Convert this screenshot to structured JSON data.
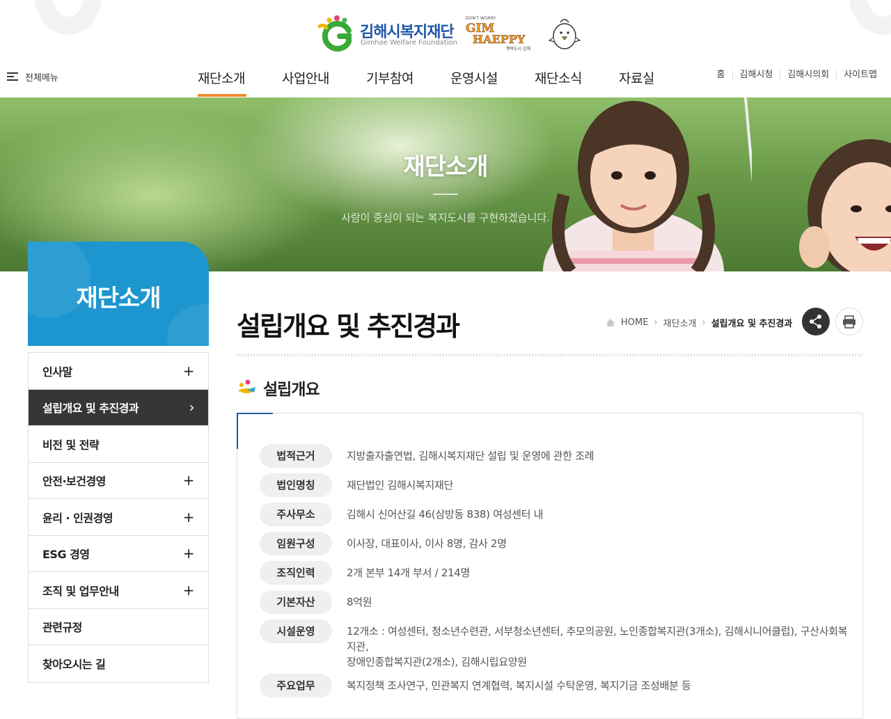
{
  "header": {
    "logo": {
      "name_ko": "김해시복지재단",
      "name_en": "Gimhae Welfare Foundation",
      "slogan_top": "DON'T WORRY",
      "slogan_main": "GIM HAEPPY",
      "slogan_bottom": "행복도시 김해"
    },
    "all_menu_label": "전체메뉴",
    "gnb": [
      {
        "label": "재단소개",
        "active": true
      },
      {
        "label": "사업안내",
        "active": false
      },
      {
        "label": "기부참여",
        "active": false
      },
      {
        "label": "운영시설",
        "active": false
      },
      {
        "label": "재단소식",
        "active": false
      },
      {
        "label": "자료실",
        "active": false
      }
    ],
    "util": [
      "홈",
      "김해시청",
      "김해시의회",
      "사이트맵"
    ]
  },
  "visual": {
    "title": "재단소개",
    "subtitle": "사람이 중심이 되는 복지도시를 구현하겠습니다."
  },
  "lnb": {
    "title": "재단소개",
    "items": [
      {
        "label": "인사말",
        "symbol": "+",
        "active": false
      },
      {
        "label": "설립개요 및 추진경과",
        "symbol": "›",
        "active": true
      },
      {
        "label": "비전 및 전략",
        "symbol": "",
        "active": false
      },
      {
        "label": "안전·보건경영",
        "symbol": "+",
        "active": false
      },
      {
        "label": "윤리 · 인권경영",
        "symbol": "+",
        "active": false
      },
      {
        "label": "ESG 경영",
        "symbol": "+",
        "active": false
      },
      {
        "label": "조직 및 업무안내",
        "symbol": "+",
        "active": false
      },
      {
        "label": "관련규정",
        "symbol": "",
        "active": false
      },
      {
        "label": "찾아오시는 길",
        "symbol": "",
        "active": false
      }
    ]
  },
  "content": {
    "page_title": "설립개요 및 추진경과",
    "breadcrumb": [
      "HOME",
      "재단소개",
      "설립개요 및 추진경과"
    ],
    "section_title": "설립개요",
    "rows": [
      {
        "label": "법적근거",
        "lines": [
          "지방출자출연법, 김해시복지재단 설립 및 운영에 관한 조례"
        ]
      },
      {
        "label": "법인명칭",
        "lines": [
          "재단법인 김해시복지재단"
        ]
      },
      {
        "label": "주사무소",
        "lines": [
          "김해시 신어산길 46(삼방동 838) 여성센터 내"
        ]
      },
      {
        "label": "임원구성",
        "lines": [
          "이사장, 대표이사, 이사 8명, 감사 2명"
        ]
      },
      {
        "label": "조직인력",
        "lines": [
          "2개 본부 14개 부서 / 214명"
        ]
      },
      {
        "label": "기본자산",
        "lines": [
          "8억원"
        ]
      },
      {
        "label": "시설운영",
        "lines": [
          "12개소 : 여성센터, 청소년수련관, 서부청소년센터, 추모의공원, 노인종합복지관(3개소), 김해시니어클럽), 구산사회복지관,",
          "장애인종합복지관(2개소), 김해시립요양원"
        ]
      },
      {
        "label": "주요업무",
        "lines": [
          "복지정책 조사연구, 민관복지 연계협력, 복지시설 수탁운영, 복지기금 조성배분 등"
        ]
      }
    ]
  },
  "colors": {
    "accent_orange": "#f08c2e",
    "lnb_blue": "#1d96cf",
    "active_dark": "#363636",
    "corner_blue": "#1e5aa8"
  }
}
